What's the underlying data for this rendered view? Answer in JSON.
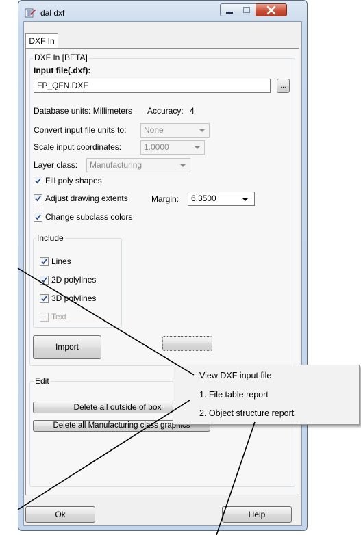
{
  "window": {
    "title": "dal dxf",
    "icon": "app-icon",
    "controls": [
      "minimize-icon",
      "maximize-icon",
      "close-icon"
    ]
  },
  "tabs": [
    {
      "label": "DXF In",
      "active": true
    }
  ],
  "dxf_in_group": {
    "label": "DXF In [BETA]",
    "input_file_label": "Input file(.dxf):",
    "input_file_value": "FP_QFN.DXF",
    "browse_label": "...",
    "database_units": "Database units: Millimeters",
    "accuracy_label": "Accuracy:",
    "accuracy_value": "4",
    "convert_units_label": "Convert input file units to:",
    "convert_units_value": "None",
    "scale_label": "Scale input coordinates:",
    "scale_value": "1.0000",
    "layer_class_label": "Layer class:",
    "layer_class_value": "Manufacturing",
    "fill_poly_label": "Fill poly shapes",
    "fill_poly_checked": true,
    "adjust_extents_label": "Adjust drawing extents",
    "adjust_extents_checked": true,
    "margin_label": "Margin:",
    "margin_value": "6.3500",
    "change_subclass_label": "Change subclass colors",
    "change_subclass_checked": true,
    "include_group": {
      "label": "Include",
      "items": [
        {
          "label": "Lines",
          "checked": true,
          "enabled": true
        },
        {
          "label": "2D polylines",
          "checked": true,
          "enabled": true
        },
        {
          "label": "3D polylines",
          "checked": true,
          "enabled": true
        },
        {
          "label": "Text",
          "checked": false,
          "enabled": false
        }
      ]
    },
    "import_button": "Import"
  },
  "edit_group": {
    "label": "Edit",
    "delete_outside_button": "Delete all outside of box",
    "help_button": "?",
    "delete_class_button": "Delete all Manufacturing class graphics"
  },
  "footer": {
    "ok_button": "Ok",
    "help_button": "Help"
  },
  "context_menu": {
    "items": [
      "View DXF input file",
      "1. File table report",
      "2. Object structure report"
    ]
  },
  "colors": {
    "title_gradient": "#c9d9ec",
    "close_button": "#c9533b",
    "checkmark": "#2a4a8a"
  }
}
